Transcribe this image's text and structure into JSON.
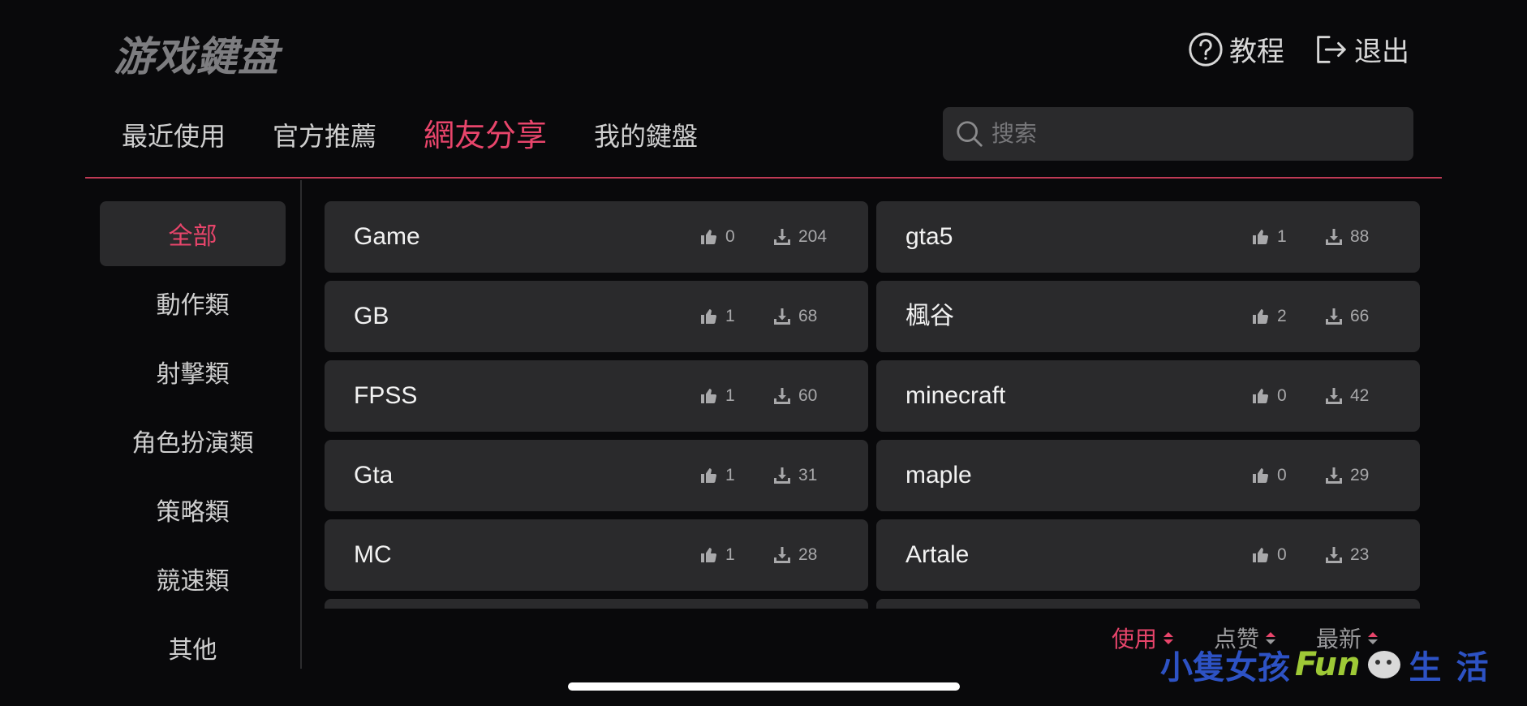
{
  "app": {
    "title": "游戏鍵盘"
  },
  "header": {
    "tutorial_label": "教程",
    "logout_label": "退出"
  },
  "tabs": [
    {
      "label": "最近使用"
    },
    {
      "label": "官方推薦"
    },
    {
      "label": "網友分享"
    },
    {
      "label": "我的鍵盤"
    }
  ],
  "active_tab": "網友分享",
  "search": {
    "placeholder": "搜索",
    "value": ""
  },
  "sidebar": {
    "items": [
      {
        "label": "全部"
      },
      {
        "label": "動作類"
      },
      {
        "label": "射擊類"
      },
      {
        "label": "角色扮演類"
      },
      {
        "label": "策略類"
      },
      {
        "label": "競速類"
      },
      {
        "label": "其他"
      }
    ],
    "active": "全部"
  },
  "keyboards": [
    {
      "name": "Game",
      "likes": "0",
      "downloads": "204"
    },
    {
      "name": "gta5",
      "likes": "1",
      "downloads": "88"
    },
    {
      "name": "GB",
      "likes": "1",
      "downloads": "68"
    },
    {
      "name": "楓谷",
      "likes": "2",
      "downloads": "66"
    },
    {
      "name": "FPSS",
      "likes": "1",
      "downloads": "60"
    },
    {
      "name": "minecraft",
      "likes": "0",
      "downloads": "42"
    },
    {
      "name": "Gta",
      "likes": "1",
      "downloads": "31"
    },
    {
      "name": "maple",
      "likes": "0",
      "downloads": "29"
    },
    {
      "name": "MC",
      "likes": "1",
      "downloads": "28"
    },
    {
      "name": "Artale",
      "likes": "0",
      "downloads": "23"
    },
    {
      "name": "",
      "likes": "",
      "downloads": ""
    },
    {
      "name": "",
      "likes": "",
      "downloads": ""
    }
  ],
  "sort": {
    "items": [
      {
        "label": "使用"
      },
      {
        "label": "点赞"
      },
      {
        "label": "最新"
      }
    ],
    "active": "使用"
  },
  "watermark": {
    "text_a": "小隻女孩",
    "text_b": "Fun",
    "text_c": "生活"
  },
  "colors": {
    "accent": "#e8456b",
    "background": "#09090b",
    "card": "#2a2a2c",
    "muted_text": "#a8a8aa"
  }
}
